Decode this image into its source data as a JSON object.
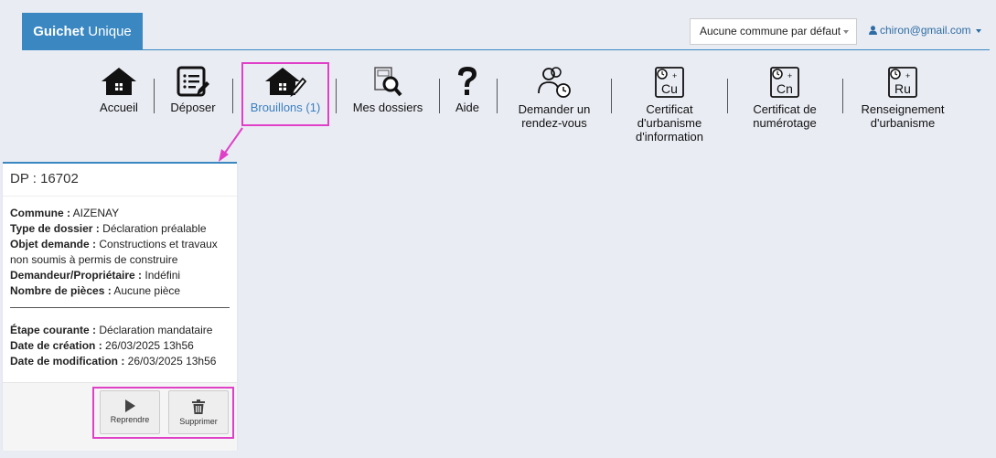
{
  "header": {
    "brand_bold": "Guichet",
    "brand_rest": " Unique",
    "commune_select": "Aucune commune par défaut",
    "user_email": "chiron@gmail.com"
  },
  "nav": [
    {
      "label": "Accueil"
    },
    {
      "label": "Déposer"
    },
    {
      "label": "Brouillons (1)"
    },
    {
      "label": "Mes dossiers"
    },
    {
      "label": "Aide"
    },
    {
      "label": "Demander un rendez-vous"
    },
    {
      "label": "Certificat d'urbanisme d'information"
    },
    {
      "label": "Certificat de numérotage"
    },
    {
      "label": "Renseignement d'urbanisme"
    }
  ],
  "icons": {
    "cu": "Cu",
    "cn": "Cn",
    "ru": "Ru",
    "plus": "+"
  },
  "card": {
    "title": "DP : 16702",
    "commune_label": "Commune :",
    "commune_value": " AIZENAY",
    "type_label": "Type de dossier :",
    "type_value": " Déclaration préalable",
    "objet_label": "Objet demande :",
    "objet_value": " Constructions et travaux non soumis à permis de construire",
    "demandeur_label": "Demandeur/Propriétaire :",
    "demandeur_value": " Indéfini",
    "pieces_label": "Nombre de pièces :",
    "pieces_value": " Aucune pièce",
    "etape_label": "Étape courante :",
    "etape_value": " Déclaration mandataire",
    "creation_label": "Date de création :",
    "creation_value": " 26/03/2025 13h56",
    "modif_label": "Date de modification :",
    "modif_value": " 26/03/2025 13h56",
    "resume_button": "Reprendre",
    "delete_button": "Supprimer"
  }
}
